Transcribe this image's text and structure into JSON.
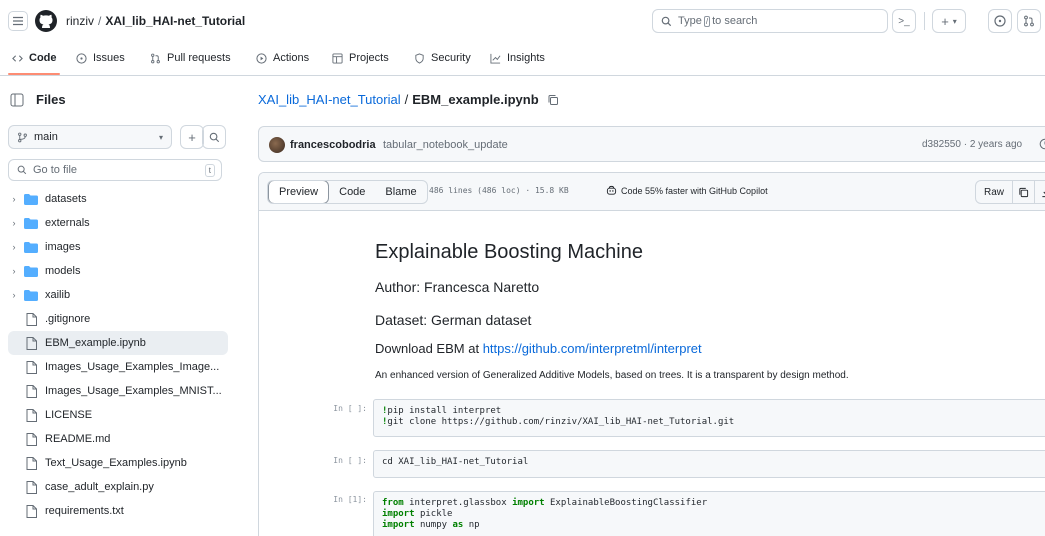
{
  "header": {
    "owner": "rinziv",
    "path_separator": "/",
    "repo": "XAI_lib_HAI-net_Tutorial",
    "search_prefix": "Type",
    "search_key": "/",
    "search_suffix": "to search",
    "command_label": ">_",
    "create_label": "+"
  },
  "nav": {
    "tabs": [
      {
        "label": "Code",
        "icon": "code-icon",
        "active": true
      },
      {
        "label": "Issues",
        "icon": "issue-icon"
      },
      {
        "label": "Pull requests",
        "icon": "pull-request-icon"
      },
      {
        "label": "Actions",
        "icon": "play-icon"
      },
      {
        "label": "Projects",
        "icon": "table-icon"
      },
      {
        "label": "Security",
        "icon": "shield-icon"
      },
      {
        "label": "Insights",
        "icon": "graph-icon"
      }
    ]
  },
  "sidebar": {
    "title": "Files",
    "branch": "main",
    "goto_placeholder": "Go to file",
    "goto_shortcut": "t",
    "items": [
      {
        "name": "datasets",
        "type": "folder"
      },
      {
        "name": "externals",
        "type": "folder"
      },
      {
        "name": "images",
        "type": "folder"
      },
      {
        "name": "models",
        "type": "folder"
      },
      {
        "name": "xailib",
        "type": "folder"
      },
      {
        "name": ".gitignore",
        "type": "file"
      },
      {
        "name": "EBM_example.ipynb",
        "type": "file",
        "selected": true
      },
      {
        "name": "Images_Usage_Examples_Image...",
        "type": "file"
      },
      {
        "name": "Images_Usage_Examples_MNIST...",
        "type": "file"
      },
      {
        "name": "LICENSE",
        "type": "file"
      },
      {
        "name": "README.md",
        "type": "file"
      },
      {
        "name": "Text_Usage_Examples.ipynb",
        "type": "file"
      },
      {
        "name": "case_adult_explain.py",
        "type": "file"
      },
      {
        "name": "requirements.txt",
        "type": "file"
      }
    ]
  },
  "breadcrumb": {
    "repo": "XAI_lib_HAI-net_Tutorial",
    "separator": "/",
    "file": "EBM_example.ipynb"
  },
  "commit": {
    "author": "francescobodria",
    "message": "tabular_notebook_update",
    "meta": "d382550 · 2 years ago"
  },
  "file_toolbar": {
    "preview": "Preview",
    "code": "Code",
    "blame": "Blame",
    "info": "486 lines (486 loc) · 15.8 KB",
    "copilot": "Code 55% faster with GitHub Copilot",
    "raw": "Raw"
  },
  "notebook": {
    "title": "Explainable Boosting Machine",
    "author": "Author: Francesca Naretto",
    "dataset": "Dataset: German dataset",
    "download_prefix": "Download EBM at",
    "download_link": "https://github.com/interpretml/interpret",
    "description": "An enhanced version of Generalized Additive Models, based on trees. It is a transparent by design method.",
    "cells": [
      {
        "label": "In [ ]:",
        "lines": [
          "!pip install interpret",
          "!git clone https://github.com/rinziv/XAI_lib_HAI-net_Tutorial.git"
        ]
      },
      {
        "label": "In [ ]:",
        "lines": [
          "cd XAI_lib_HAI-net_Tutorial"
        ]
      },
      {
        "label": "In [1]:",
        "lines": [
          "from interpret.glassbox import ExplainableBoostingClassifier",
          "import pickle",
          "import numpy as np"
        ]
      }
    ]
  },
  "colors": {
    "accent_link": "#0969da",
    "folder": "#54aeff",
    "tab_underline": "#fd8c73"
  }
}
